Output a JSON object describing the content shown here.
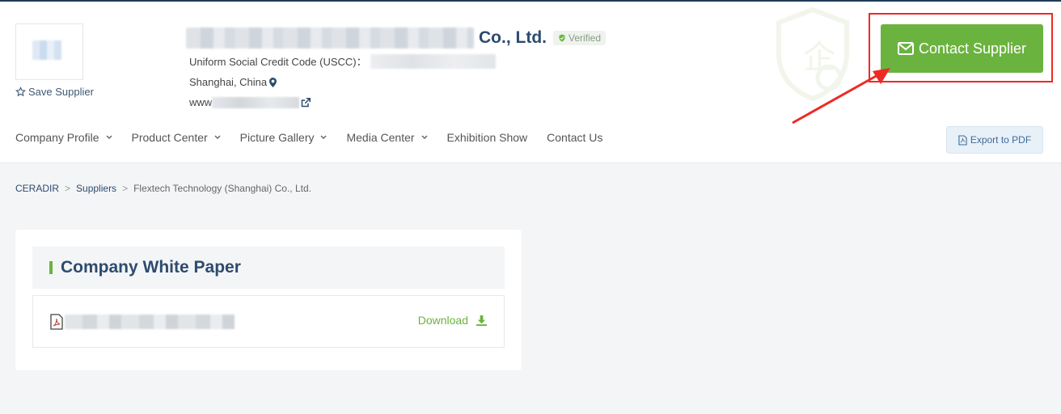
{
  "header": {
    "company_name_visible": "Co., Ltd.",
    "verified_label": "Verified",
    "uscc_label": "Uniform Social Credit Code (USCC)：",
    "location": "Shanghai, China",
    "website_prefix": "www",
    "save_label": "Save Supplier",
    "contact_button_label": "Contact Supplier",
    "export_label": "Export to PDF"
  },
  "nav": {
    "items": [
      {
        "label": "Company Profile",
        "has_dropdown": true
      },
      {
        "label": "Product Center",
        "has_dropdown": true
      },
      {
        "label": "Picture Gallery",
        "has_dropdown": true
      },
      {
        "label": "Media Center",
        "has_dropdown": true
      },
      {
        "label": "Exhibition Show",
        "has_dropdown": false
      },
      {
        "label": "Contact Us",
        "has_dropdown": false
      }
    ]
  },
  "breadcrumb": {
    "items": [
      "CERADIR",
      "Suppliers",
      "Flextech Technology (Shanghai) Co., Ltd."
    ],
    "separator": ">"
  },
  "white_paper": {
    "title": "Company White Paper",
    "download_label": "Download"
  },
  "colors": {
    "accent_green": "#6bb33f",
    "navy": "#2d4b6e",
    "highlight_red": "#ee2a24"
  },
  "icons": [
    "star-icon",
    "verified-shield-icon",
    "map-marker-icon",
    "external-link-icon",
    "envelope-icon",
    "pdf-file-icon",
    "download-icon",
    "chevron-down-icon"
  ]
}
